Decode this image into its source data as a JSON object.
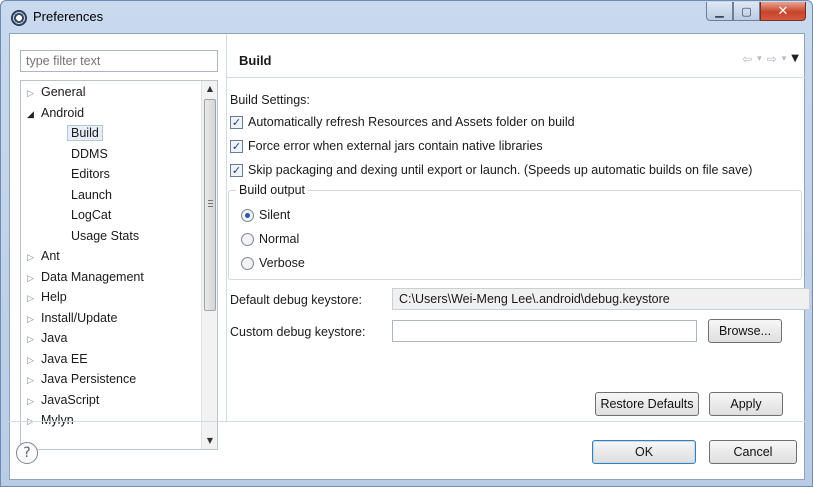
{
  "window": {
    "title": "Preferences",
    "minimize_glyph": "▁",
    "maximize_glyph": "▢",
    "close_glyph": "✕"
  },
  "sidebar": {
    "filter_placeholder": "type filter text",
    "items": [
      {
        "label": "General",
        "level": 0,
        "expander": "▷"
      },
      {
        "label": "Android",
        "level": 0,
        "expander": "◢"
      },
      {
        "label": "Build",
        "level": 1,
        "expander": "",
        "selected": true
      },
      {
        "label": "DDMS",
        "level": 1,
        "expander": ""
      },
      {
        "label": "Editors",
        "level": 1,
        "expander": ""
      },
      {
        "label": "Launch",
        "level": 1,
        "expander": ""
      },
      {
        "label": "LogCat",
        "level": 1,
        "expander": ""
      },
      {
        "label": "Usage Stats",
        "level": 1,
        "expander": ""
      },
      {
        "label": "Ant",
        "level": 0,
        "expander": "▷"
      },
      {
        "label": "Data Management",
        "level": 0,
        "expander": "▷"
      },
      {
        "label": "Help",
        "level": 0,
        "expander": "▷"
      },
      {
        "label": "Install/Update",
        "level": 0,
        "expander": "▷"
      },
      {
        "label": "Java",
        "level": 0,
        "expander": "▷"
      },
      {
        "label": "Java EE",
        "level": 0,
        "expander": "▷"
      },
      {
        "label": "Java Persistence",
        "level": 0,
        "expander": "▷"
      },
      {
        "label": "JavaScript",
        "level": 0,
        "expander": "▷"
      },
      {
        "label": "Mylyn",
        "level": 0,
        "expander": "▷"
      }
    ]
  },
  "page": {
    "title": "Build",
    "nav": {
      "back": "⇦",
      "forward": "⇨",
      "dropdown": "▾",
      "menu": "▼"
    },
    "build_settings_label": "Build Settings:",
    "checkboxes": [
      {
        "label": "Automatically refresh Resources and Assets folder on build",
        "checked": true
      },
      {
        "label": "Force error when external jars contain native libraries",
        "checked": true
      },
      {
        "label": "Skip packaging and dexing until export or launch. (Speeds up automatic builds on file save)",
        "checked": true
      }
    ],
    "check_glyph": "✓",
    "build_output": {
      "label": "Build output",
      "options": [
        {
          "label": "Silent",
          "selected": true
        },
        {
          "label": "Normal",
          "selected": false
        },
        {
          "label": "Verbose",
          "selected": false
        }
      ]
    },
    "default_keystore": {
      "label": "Default debug keystore:",
      "value": "C:\\Users\\Wei-Meng Lee\\.android\\debug.keystore"
    },
    "custom_keystore": {
      "label": "Custom debug keystore:",
      "value": "",
      "browse_label": "Browse..."
    },
    "restore_defaults_label": "Restore Defaults",
    "apply_label": "Apply"
  },
  "footer": {
    "help_glyph": "?",
    "ok_label": "OK",
    "cancel_label": "Cancel"
  },
  "colors": {
    "title_bar": "#c9d9ee",
    "close_button": "#c8442c",
    "selection": "#e8eef6",
    "radio_dot": "#2a56a8"
  }
}
